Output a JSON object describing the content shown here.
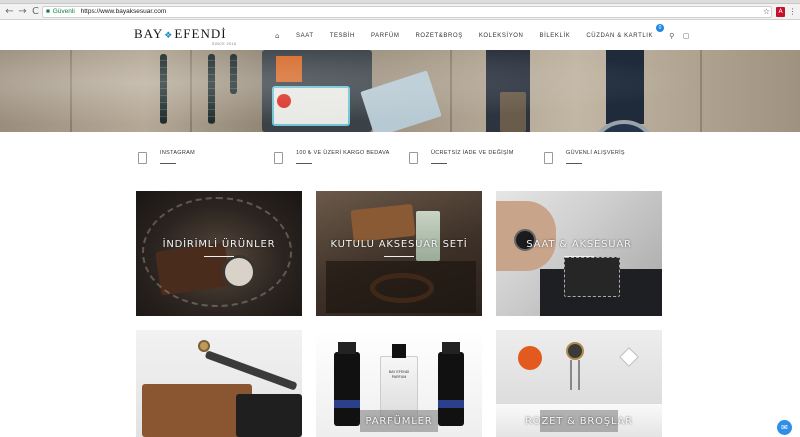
{
  "browser": {
    "back_icon": "←",
    "forward_icon": "→",
    "reload_icon": "C",
    "secure_label": "Güvenli",
    "url": "https://www.bayaksesuar.com",
    "bookmark_icon": "☆",
    "pdf_icon": "A"
  },
  "header": {
    "logo_left": "BAY",
    "logo_right": "EFENDİ",
    "logo_sub": "SINCE 2016",
    "nav_items": [
      "SAAT",
      "TESBİH",
      "PARFÜM",
      "ROZET&BROŞ",
      "KOLEKSİYON",
      "BİLEKLİK",
      "CÜZDAN & KARTLIK"
    ],
    "cart_count": "0"
  },
  "features": [
    {
      "label": "INSTAGRAM"
    },
    {
      "label": "100 ₺ VE ÜZERİ KARGO BEDAVA"
    },
    {
      "label": "ÜCRETSİZ İADE VE DEĞİŞİM"
    },
    {
      "label": "GÜVENLİ ALIŞVERİŞ"
    }
  ],
  "tiles": [
    {
      "label": "İNDİRİMLİ ÜRÜNLER"
    },
    {
      "label": "KUTULU AKSESUAR SETİ"
    },
    {
      "label": "SAAT & AKSESUAR"
    },
    {
      "label": ""
    },
    {
      "label": "PARFÜMLER"
    },
    {
      "label": "ROZET & BROŞLAR"
    }
  ],
  "perfume_text": {
    "brand": "BAY EFENDİ",
    "type": "PARFUM"
  },
  "colors": {
    "accent": "#1e88e5",
    "secure": "#0b8043",
    "text": "#333333"
  }
}
